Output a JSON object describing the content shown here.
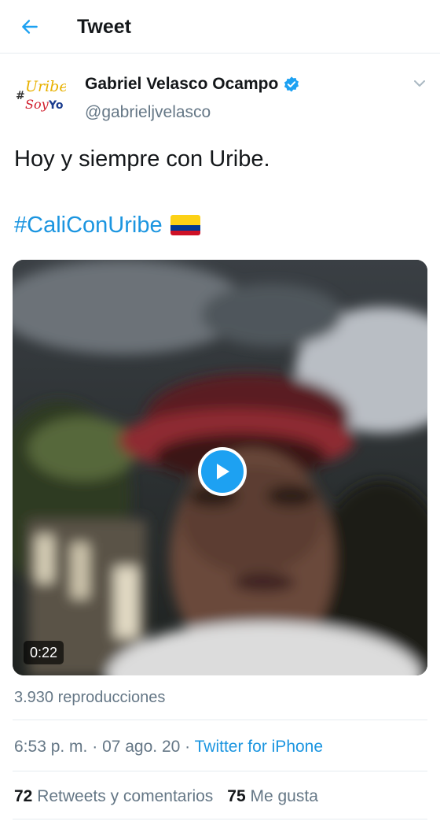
{
  "header": {
    "title": "Tweet",
    "back_icon": "arrow-left-icon"
  },
  "author": {
    "name": "Gabriel Velasco Ocampo",
    "handle": "@gabrieljvelasco",
    "verified": true,
    "avatar_text": {
      "hash": "#",
      "line1": "Uribe",
      "line2": "Soy",
      "line3": "Yo"
    }
  },
  "tweet": {
    "text": "Hoy y siempre con Uribe.",
    "hashtag": "#CaliConUribe",
    "flag_emoji": "colombia-flag-icon"
  },
  "media": {
    "type": "video",
    "duration": "0:22"
  },
  "views": "3.930 reproducciones",
  "meta": {
    "time": "6:53 p. m.",
    "sep1": " · ",
    "date": "07 ago. 20",
    "sep2": " · ",
    "source": "Twitter for iPhone"
  },
  "stats": {
    "retweets_count": "72",
    "retweets_label": "Retweets y comentarios",
    "likes_count": "75",
    "likes_label": "Me gusta"
  },
  "colors": {
    "accent": "#1da1f2",
    "link": "#1b95e0",
    "muted": "#657786",
    "text": "#14171a"
  }
}
